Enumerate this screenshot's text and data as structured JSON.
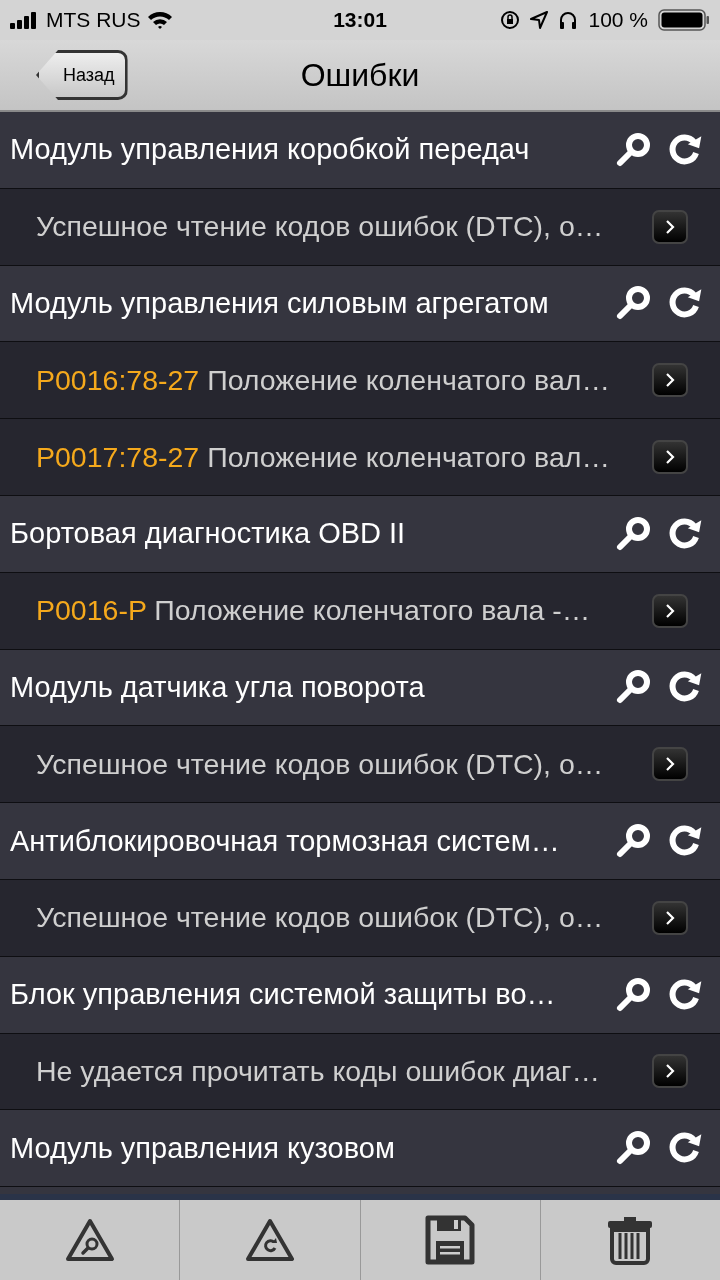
{
  "status_bar": {
    "carrier": "MTS RUS",
    "time": "13:01",
    "battery": "100 %"
  },
  "nav": {
    "back": "Назад",
    "title": "Ошибки"
  },
  "rows": [
    {
      "kind": "module",
      "text": "Модуль управления коробкой передач"
    },
    {
      "kind": "entry",
      "text": "Успешное чтение кодов ошибок (DTC), о…"
    },
    {
      "kind": "module",
      "text": "Модуль управления силовым агрегатом"
    },
    {
      "kind": "entry",
      "code": "P0016:78-27",
      "text": "Положение коленчатого вал…"
    },
    {
      "kind": "entry",
      "code": "P0017:78-27",
      "text": "Положение коленчатого вал…"
    },
    {
      "kind": "module",
      "text": "Бортовая диагностика OBD II"
    },
    {
      "kind": "entry",
      "code": "P0016-P",
      "text": "Положение коленчатого вала -…"
    },
    {
      "kind": "module",
      "text": "Модуль датчика угла поворота"
    },
    {
      "kind": "entry",
      "text": "Успешное чтение кодов ошибок (DTC), о…"
    },
    {
      "kind": "module",
      "text": "Антиблокировочная тормозная систем…"
    },
    {
      "kind": "entry",
      "text": "Успешное чтение кодов ошибок (DTC), о…"
    },
    {
      "kind": "module",
      "text": "Блок управления системой защиты во…"
    },
    {
      "kind": "entry",
      "text": "Не удается прочитать коды ошибок диаг…"
    },
    {
      "kind": "module",
      "text": "Модуль управления кузовом"
    }
  ],
  "toolbar": [
    {
      "kind": "scan"
    },
    {
      "kind": "refresh"
    },
    {
      "kind": "save"
    },
    {
      "kind": "delete"
    }
  ]
}
